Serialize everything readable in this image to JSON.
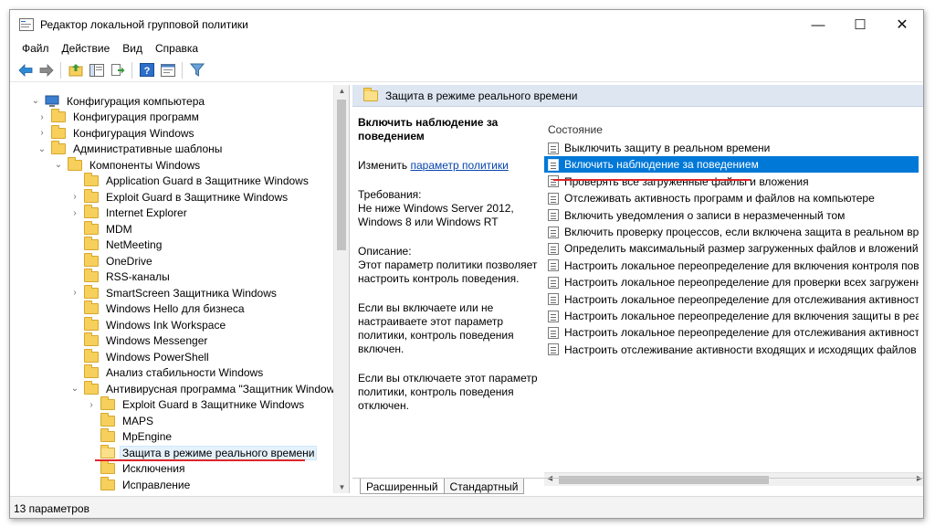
{
  "window": {
    "title": "Редактор локальной групповой политики",
    "controls": {
      "minimize": "—",
      "maximize": "☐",
      "close": "✕"
    }
  },
  "menu": [
    "Файл",
    "Действие",
    "Вид",
    "Справка"
  ],
  "toolbar": [
    "back-icon",
    "forward-icon",
    "up-folder-icon",
    "show-tree-icon",
    "export-icon",
    "help-icon",
    "properties-icon",
    "filter-icon"
  ],
  "tree": [
    {
      "label": "Конфигурация компьютера",
      "level": 0,
      "expander": "down",
      "icon": "computer"
    },
    {
      "label": "Конфигурация программ",
      "level": 1,
      "expander": "right"
    },
    {
      "label": "Конфигурация Windows",
      "level": 1,
      "expander": "right"
    },
    {
      "label": "Административные шаблоны",
      "level": 1,
      "expander": "down"
    },
    {
      "label": "Компоненты Windows",
      "level": 2,
      "expander": "down"
    },
    {
      "label": "Application Guard в Защитнике Windows",
      "level": 3,
      "expander": ""
    },
    {
      "label": "Exploit Guard в Защитнике Windows",
      "level": 3,
      "expander": "right"
    },
    {
      "label": "Internet Explorer",
      "level": 3,
      "expander": "right"
    },
    {
      "label": "MDM",
      "level": 3,
      "expander": ""
    },
    {
      "label": "NetMeeting",
      "level": 3,
      "expander": ""
    },
    {
      "label": "OneDrive",
      "level": 3,
      "expander": ""
    },
    {
      "label": "RSS-каналы",
      "level": 3,
      "expander": ""
    },
    {
      "label": "SmartScreen Защитника Windows",
      "level": 3,
      "expander": "right"
    },
    {
      "label": "Windows Hello для бизнеса",
      "level": 3,
      "expander": ""
    },
    {
      "label": "Windows Ink Workspace",
      "level": 3,
      "expander": ""
    },
    {
      "label": "Windows Messenger",
      "level": 3,
      "expander": ""
    },
    {
      "label": "Windows PowerShell",
      "level": 3,
      "expander": ""
    },
    {
      "label": "Анализ стабильности Windows",
      "level": 3,
      "expander": ""
    },
    {
      "label": "Антивирусная программа \"Защитник Windows\"",
      "level": 3,
      "expander": "down"
    },
    {
      "label": "Exploit Guard в Защитнике Windows",
      "level": 4,
      "expander": "right"
    },
    {
      "label": "MAPS",
      "level": 4,
      "expander": ""
    },
    {
      "label": "MpEngine",
      "level": 4,
      "expander": ""
    },
    {
      "label": "Защита в режиме реального времени",
      "level": 4,
      "expander": "",
      "selected": true
    },
    {
      "label": "Исключения",
      "level": 4,
      "expander": ""
    },
    {
      "label": "Исправление",
      "level": 4,
      "expander": ""
    }
  ],
  "header": {
    "title": "Защита в режиме реального времени"
  },
  "description": {
    "title": "Включить наблюдение за поведением",
    "edit_prefix": "Изменить",
    "edit_link": "параметр политики",
    "requirements_label": "Требования:",
    "requirements_text": "Не ниже Windows Server 2012, Windows 8 или Windows RT",
    "description_label": "Описание:",
    "description_text": "Этот параметр политики позволяет настроить контроль поведения.",
    "if_enabled": "Если вы включаете или не настраиваете этот параметр политики, контроль поведения включен.",
    "if_disabled": "Если вы отключаете этот параметр политики, контроль поведения отключен."
  },
  "list": {
    "column_header": "Состояние",
    "items": [
      "Выключить защиту в реальном времени",
      "Включить наблюдение за поведением",
      "Проверять все загруженные файлы и вложения",
      "Отслеживать активность программ и файлов на компьютере",
      "Включить уведомления о записи в неразмеченный том",
      "Включить проверку процессов, если включена защита в реальном вре...",
      "Определить максимальный размер загруженных файлов и вложений дл...",
      "Настроить локальное переопределение для включения контроля повед...",
      "Настроить локальное переопределение для проверки всех загруженны...",
      "Настроить локальное переопределение для отслеживания активности ...",
      "Настроить локальное переопределение для включения защиты в реаль...",
      "Настроить локальное переопределение для отслеживания активности в...",
      "Настроить отслеживание активности входящих и исходящих файлов и п..."
    ],
    "selected_index": 1
  },
  "tabs": [
    "Расширенный",
    "Стандартный"
  ],
  "status": {
    "text": "13 параметров"
  },
  "colors": {
    "accent": "#0078d7",
    "highlight_underline": "#e0262b",
    "header_bg": "#dde6f1"
  }
}
